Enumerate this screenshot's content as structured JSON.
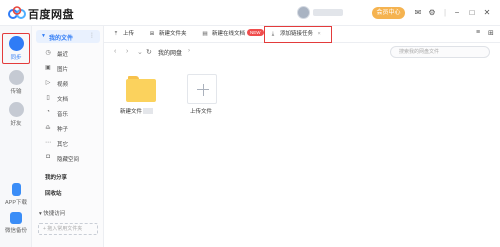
{
  "app": {
    "title": "百度网盘"
  },
  "header": {
    "member_label": "会员中心"
  },
  "rail": {
    "items": [
      {
        "label": "同步"
      },
      {
        "label": "传输"
      },
      {
        "label": "好友"
      },
      {
        "label": "APP下载"
      },
      {
        "label": "微信备份"
      }
    ]
  },
  "sidenav": {
    "head": "我的文件",
    "items": [
      {
        "label": "最近",
        "icon": "clock-icon"
      },
      {
        "label": "图片",
        "icon": "image-icon"
      },
      {
        "label": "视频",
        "icon": "video-icon"
      },
      {
        "label": "文档",
        "icon": "document-icon"
      },
      {
        "label": "音乐",
        "icon": "music-icon"
      },
      {
        "label": "种子",
        "icon": "seed-icon"
      },
      {
        "label": "其它",
        "icon": "more-icon"
      },
      {
        "label": "隐藏空间",
        "icon": "lock-icon"
      }
    ],
    "share": "我的分享",
    "recycle": "回收站",
    "quick_access": "快捷访问",
    "add_quick": "+ 拖入常用文件夹"
  },
  "toolbar": {
    "upload": "上传",
    "new_folder": "新建文件夹",
    "new_online_doc": "新建在线文档",
    "new_badge": "NEW",
    "offline_task": "添加链接任务"
  },
  "address": {
    "crumb": "我的网盘",
    "search_placeholder": "搜索我的网盘文件"
  },
  "files": [
    {
      "name": "新建文件",
      "type": "folder"
    },
    {
      "name": "上传文件",
      "type": "upload"
    }
  ]
}
